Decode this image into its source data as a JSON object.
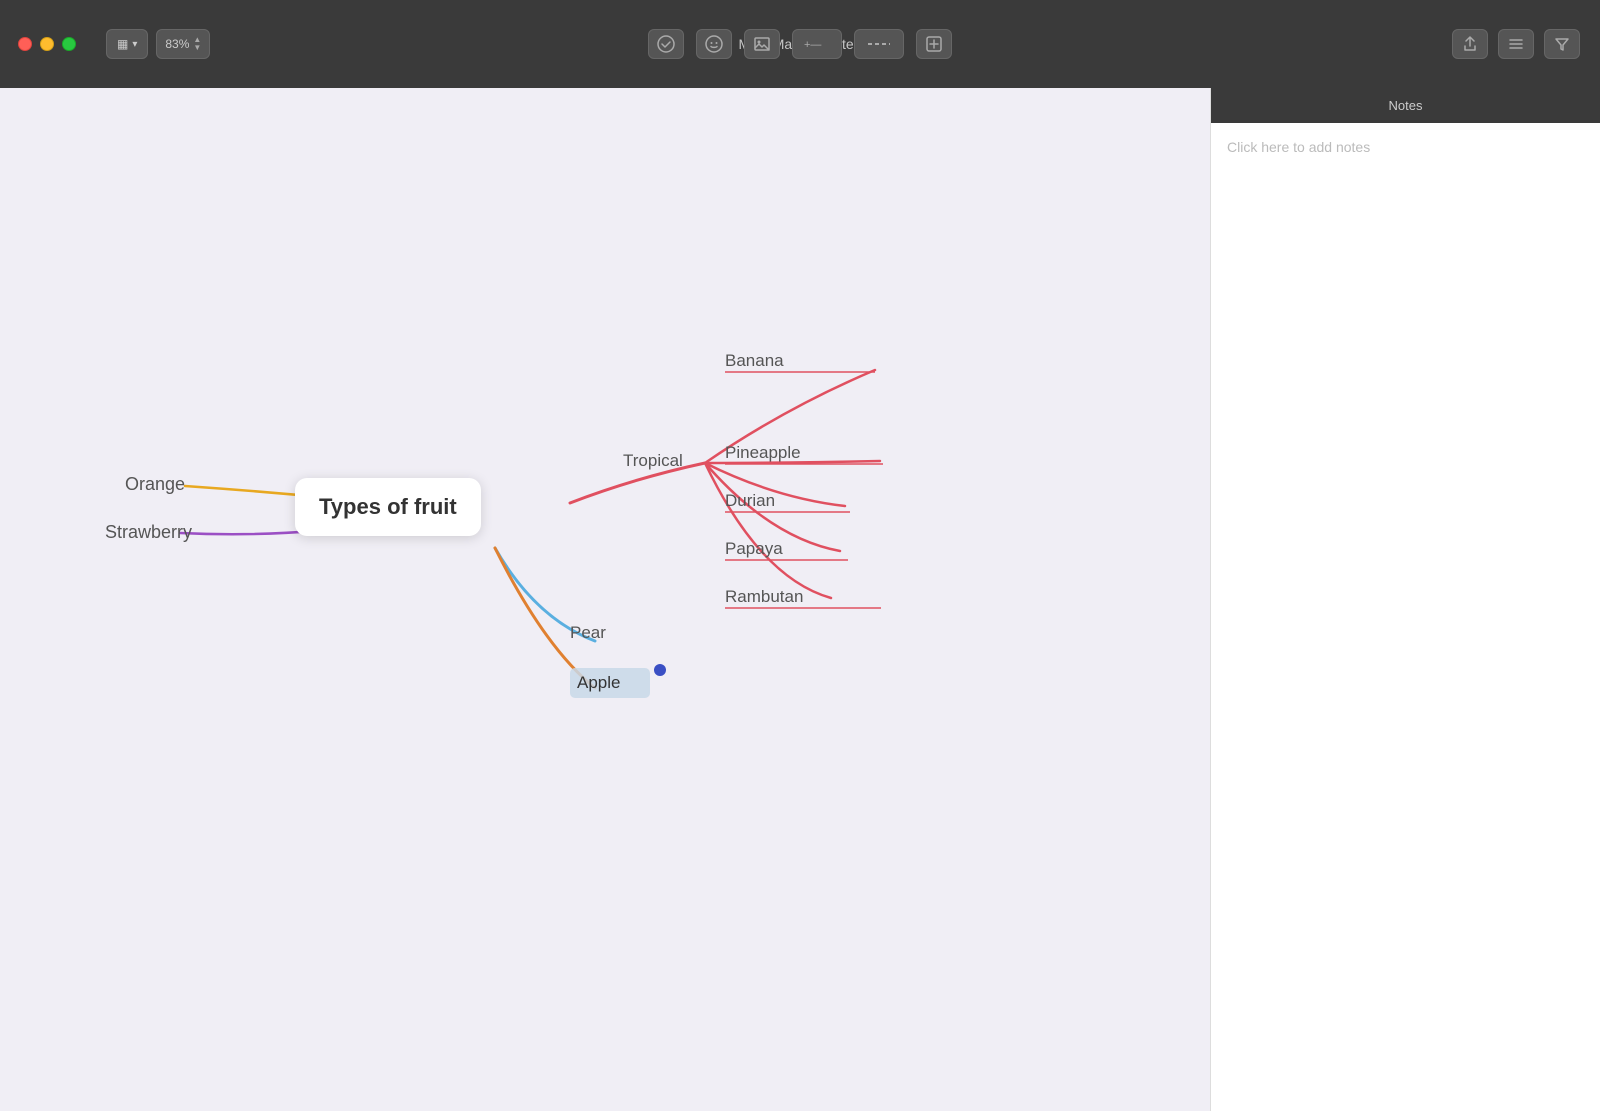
{
  "window": {
    "title": "Mind Map — Edited"
  },
  "titlebar": {
    "zoom_value": "83%",
    "zoom_up_arrow": "▲",
    "zoom_down_arrow": "▼"
  },
  "toolbar": {
    "view_icon": "▦",
    "check_icon": "✓",
    "smiley_icon": "☺",
    "image_icon": "⛰",
    "add_connection_icon": "+—",
    "connection_icon": "——",
    "add_node_icon": "⊞",
    "share_icon": "↑",
    "list_icon": "≡",
    "filter_icon": "⌘"
  },
  "notes": {
    "header": "Notes",
    "placeholder": "Click here to add notes"
  },
  "mindmap": {
    "central_node": "Types of fruit",
    "branches": [
      {
        "name": "Orange",
        "color": "#e8a820",
        "parent": "central"
      },
      {
        "name": "Strawberry",
        "color": "#9b4fc4",
        "parent": "central"
      },
      {
        "name": "Tropical",
        "color": "#e05060",
        "parent": "central",
        "children": [
          {
            "name": "Banana",
            "color": "#e05060"
          },
          {
            "name": "Pineapple",
            "color": "#e05060"
          },
          {
            "name": "Durian",
            "color": "#e05060"
          },
          {
            "name": "Papaya",
            "color": "#e05060"
          },
          {
            "name": "Rambutan",
            "color": "#e05060"
          }
        ]
      },
      {
        "name": "Pear",
        "color": "#5aafe0",
        "parent": "central"
      },
      {
        "name": "Apple",
        "color": "#e08030",
        "parent": "central",
        "selected": true
      }
    ]
  }
}
